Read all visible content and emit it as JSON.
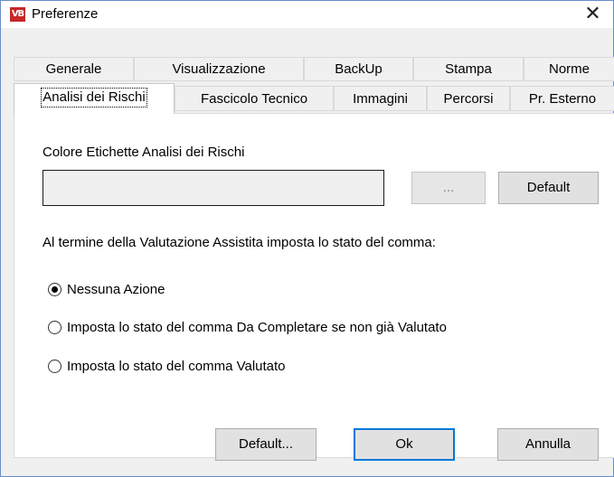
{
  "window": {
    "icon_text": "VB",
    "title": "Preferenze",
    "close_glyph": "✕"
  },
  "tabs": {
    "row1": [
      {
        "label": "Generale"
      },
      {
        "label": "Visualizzazione"
      },
      {
        "label": "BackUp"
      },
      {
        "label": "Stampa"
      },
      {
        "label": "Norme"
      }
    ],
    "row2": [
      {
        "label": "Analisi dei Rischi",
        "active": true
      },
      {
        "label": "Fascicolo Tecnico"
      },
      {
        "label": "Immagini"
      },
      {
        "label": "Percorsi"
      },
      {
        "label": "Pr. Esterno"
      }
    ]
  },
  "panel": {
    "color_label": "Colore Etichette Analisi dei Rischi",
    "browse_label": "...",
    "default_label": "Default",
    "assist_label": "Al termine della Valutazione Assistita imposta lo stato del comma:",
    "radios": [
      {
        "label": "Nessuna Azione",
        "checked": true
      },
      {
        "label": "Imposta lo stato del comma Da Completare se non già Valutato",
        "checked": false
      },
      {
        "label": "Imposta lo stato del comma Valutato",
        "checked": false
      }
    ]
  },
  "footer": {
    "default_label": "Default...",
    "ok_label": "Ok",
    "cancel_label": "Annulla"
  },
  "colors": {
    "accent": "#0078d7",
    "icon_red": "#c62828",
    "dialog_bg": "#f0f0f0"
  }
}
